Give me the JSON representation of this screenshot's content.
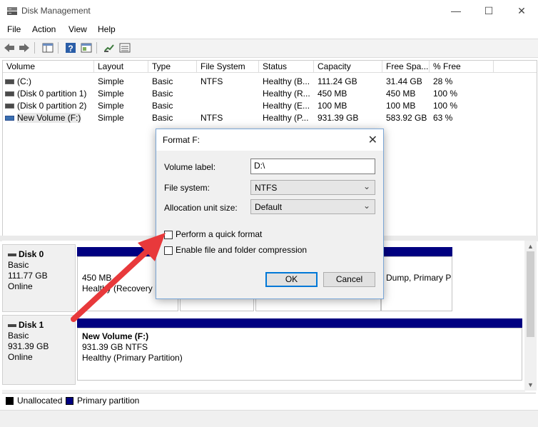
{
  "window": {
    "title": "Disk Management",
    "controls": {
      "minimize": "—",
      "maximize": "☐",
      "close": "✕"
    }
  },
  "menu": [
    "File",
    "Action",
    "View",
    "Help"
  ],
  "toolbar": {
    "icons": [
      "back-arrow-icon",
      "forward-arrow-icon",
      "console-tree-icon",
      "help-icon",
      "properties-icon",
      "connect-icon",
      "list-icon"
    ]
  },
  "volumes": {
    "columns": [
      "Volume",
      "Layout",
      "Type",
      "File System",
      "Status",
      "Capacity",
      "Free Spa...",
      "% Free"
    ],
    "rows": [
      {
        "volume": "(C:)",
        "layout": "Simple",
        "type": "Basic",
        "fs": "NTFS",
        "status": "Healthy (B...",
        "capacity": "111.24 GB",
        "free": "31.44 GB",
        "pct": "28 %"
      },
      {
        "volume": "(Disk 0 partition 1)",
        "layout": "Simple",
        "type": "Basic",
        "fs": "",
        "status": "Healthy (R...",
        "capacity": "450 MB",
        "free": "450 MB",
        "pct": "100 %"
      },
      {
        "volume": "(Disk 0 partition 2)",
        "layout": "Simple",
        "type": "Basic",
        "fs": "",
        "status": "Healthy (E...",
        "capacity": "100 MB",
        "free": "100 MB",
        "pct": "100 %"
      },
      {
        "volume": "New Volume (F:)",
        "layout": "Simple",
        "type": "Basic",
        "fs": "NTFS",
        "status": "Healthy (P...",
        "capacity": "931.39 GB",
        "free": "583.92 GB",
        "pct": "63 %"
      }
    ]
  },
  "disks": [
    {
      "name": "Disk 0",
      "type": "Basic",
      "size": "111.77 GB",
      "state": "Online",
      "partitions": [
        {
          "line1": "450 MB",
          "line2": "Healthy (Recovery Pa"
        },
        {
          "line1": "",
          "line2": ""
        },
        {
          "line1": "",
          "line2": ""
        },
        {
          "line1": "",
          "line2": "Dump, Primary Pa"
        }
      ]
    },
    {
      "name": "Disk 1",
      "type": "Basic",
      "size": "931.39 GB",
      "state": "Online",
      "partitions": [
        {
          "line1": "New Volume  (F:)",
          "line2": "931.39 GB NTFS",
          "line3": "Healthy (Primary Partition)"
        }
      ]
    }
  ],
  "legend": {
    "unallocated": "Unallocated",
    "primary": "Primary partition",
    "colors": {
      "unallocated": "#000000",
      "primary": "#000080"
    }
  },
  "dialog": {
    "title": "Format F:",
    "close": "✕",
    "volume_label": {
      "label": "Volume label:",
      "value": "D:\\"
    },
    "file_system": {
      "label": "File system:",
      "value": "NTFS"
    },
    "allocation": {
      "label": "Allocation unit size:",
      "value": "Default"
    },
    "quick_format": {
      "label": "Perform a quick format",
      "checked": false
    },
    "compression": {
      "label": "Enable file and folder compression",
      "checked": false
    },
    "ok": "OK",
    "cancel": "Cancel"
  },
  "annotation": {
    "arrow_color": "#e8393b"
  }
}
